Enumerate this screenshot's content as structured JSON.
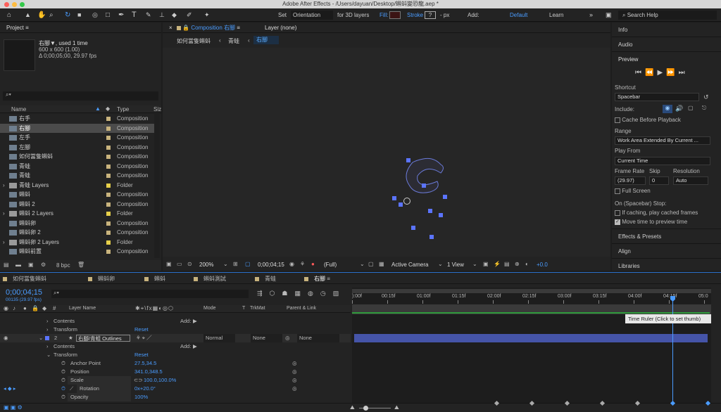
{
  "window": {
    "title": "Adobe After Effects - /Users/dayuan/Desktop/蝌蚪變恐龍.aep *"
  },
  "toolbar": {
    "set_label": "Set",
    "orientation": "Orientation",
    "for3d": "for 3D layers",
    "fill": "Fill:",
    "stroke": "Stroke",
    "stroke_value": "?",
    "px": "- px",
    "add": "Add:",
    "workspace_default": "Default",
    "workspace_learn": "Learn",
    "search_help": "Search Help"
  },
  "project": {
    "title": "Project",
    "item_name": "右腳▼",
    "used": ", used 1 time",
    "dimensions": "600 x 600 (1.00)",
    "duration": "Δ 0;00;05;00, 29.97 fps",
    "search_placeholder": "",
    "col_name": "Name",
    "col_type": "Type",
    "col_size": "Siz",
    "items": [
      {
        "name": "右手",
        "type": "Composition",
        "kind": "comp"
      },
      {
        "name": "右腳",
        "type": "Composition",
        "kind": "comp",
        "selected": true
      },
      {
        "name": "左手",
        "type": "Composition",
        "kind": "comp"
      },
      {
        "name": "左腳",
        "type": "Composition",
        "kind": "comp"
      },
      {
        "name": "如何當隻蝌蚪",
        "type": "Composition",
        "kind": "comp"
      },
      {
        "name": "青蛙",
        "type": "Composition",
        "kind": "comp"
      },
      {
        "name": "青蛙",
        "type": "Composition",
        "kind": "comp"
      },
      {
        "name": "青蛙 Layers",
        "type": "Folder",
        "kind": "folder"
      },
      {
        "name": "蝌蚪",
        "type": "Composition",
        "kind": "comp"
      },
      {
        "name": "蝌蚪 2",
        "type": "Composition",
        "kind": "comp"
      },
      {
        "name": "蝌蚪 2 Layers",
        "type": "Folder",
        "kind": "folder"
      },
      {
        "name": "蝌蚪卵",
        "type": "Composition",
        "kind": "comp"
      },
      {
        "name": "蝌蚪卵 2",
        "type": "Composition",
        "kind": "comp"
      },
      {
        "name": "蝌蚪卵 2 Layers",
        "type": "Folder",
        "kind": "folder"
      },
      {
        "name": "蝌蚪前置",
        "type": "Composition",
        "kind": "comp"
      }
    ],
    "bpc": "8 bpc"
  },
  "comp": {
    "tab_label": "Composition",
    "tab_name": "右腳",
    "layer_tab": "Layer (none)",
    "crumbs": [
      "如何當隻蝌蚪",
      "青蛙",
      "右腳"
    ],
    "zoom": "200%",
    "timecode": "0;00;04;15",
    "resolution": "(Full)",
    "camera": "Active Camera",
    "views": "1 View",
    "exposure": "+0.0"
  },
  "right": {
    "info": "Info",
    "audio": "Audio",
    "preview": "Preview",
    "shortcut_label": "Shortcut",
    "shortcut": "Spacebar",
    "include": "Include:",
    "cache_before": "Cache Before Playback",
    "range_label": "Range",
    "range": "Work Area Extended By Current ...",
    "play_from_label": "Play From",
    "play_from": "Current Time",
    "frame_rate_label": "Frame Rate",
    "skip_label": "Skip",
    "resolution_label": "Resolution",
    "frame_rate": "(29.97)",
    "skip": "0",
    "resolution": "Auto",
    "full_screen": "Full Screen",
    "on_stop": "On (Spacebar) Stop:",
    "if_caching": "If caching, play cached frames",
    "move_time": "Move time to preview time",
    "effects": "Effects & Presets",
    "align": "Align",
    "libraries": "Libraries"
  },
  "timeline": {
    "tabs": [
      "如何當隻蝌蚪",
      "蝌蚪卵",
      "蝌蚪",
      "蝌蚪測試",
      "青蛙",
      "右腳"
    ],
    "timecode": "0;00;04;15",
    "frames": "00135 (29.97 fps)",
    "col_layer_name": "Layer Name",
    "col_mode": "Mode",
    "col_t": "T",
    "col_trkmat": "TrkMat",
    "col_parent": "Parent & Link",
    "ruler": [
      "):00f",
      "00:15f",
      "01:00f",
      "01:15f",
      "02:00f",
      "02:15f",
      "03:00f",
      "03:15f",
      "04:00f",
      "04:15f",
      "05:0"
    ],
    "tooltip": "Time Ruler (Click to set thumb)",
    "rows": {
      "contents1": "Contents",
      "add1": "Add:",
      "transform1": "Transform",
      "reset1": "Reset",
      "layer_num": "2",
      "layer_name": "右腳/青蛙 Outlines",
      "layer_mode": "Normal",
      "layer_trkmat": "None",
      "layer_parent": "None",
      "contents2": "Contents",
      "add2": "Add:",
      "transform2": "Transform",
      "reset2": "Reset",
      "anchor": "Anchor Point",
      "anchor_val": "27.5,34.5",
      "position": "Position",
      "position_val": "341.0,348.5",
      "scale": "Scale",
      "scale_val": "100.0,100.0%",
      "rotation": "Rotation",
      "rotation_val": "0x+20.0°",
      "opacity": "Opacity",
      "opacity_val": "100%"
    }
  }
}
